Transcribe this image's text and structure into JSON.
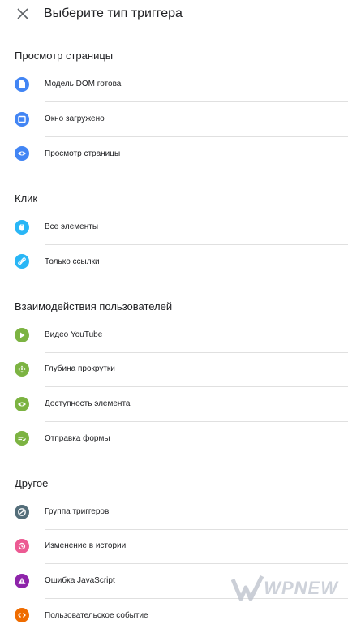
{
  "header": {
    "title": "Выберите тип триггера"
  },
  "sections": [
    {
      "title": "Просмотр страницы",
      "items": [
        {
          "label": "Модель DOM готова",
          "icon": "document-icon",
          "color": "#4285f4"
        },
        {
          "label": "Окно загружено",
          "icon": "window-icon",
          "color": "#4285f4"
        },
        {
          "label": "Просмотр страницы",
          "icon": "eye-icon",
          "color": "#4285f4"
        }
      ]
    },
    {
      "title": "Клик",
      "items": [
        {
          "label": "Все элементы",
          "icon": "mouse-icon",
          "color": "#29b6f6"
        },
        {
          "label": "Только ссылки",
          "icon": "link-icon",
          "color": "#29b6f6"
        }
      ]
    },
    {
      "title": "Взаимодействия пользователей",
      "items": [
        {
          "label": "Видео YouTube",
          "icon": "play-icon",
          "color": "#7cb342"
        },
        {
          "label": "Глубина прокрутки",
          "icon": "scroll-icon",
          "color": "#7cb342"
        },
        {
          "label": "Доступность элемента",
          "icon": "eye-icon",
          "color": "#7cb342"
        },
        {
          "label": "Отправка формы",
          "icon": "form-icon",
          "color": "#7cb342"
        }
      ]
    },
    {
      "title": "Другое",
      "items": [
        {
          "label": "Группа триггеров",
          "icon": "group-icon",
          "color": "#546e7a"
        },
        {
          "label": "Изменение в истории",
          "icon": "history-icon",
          "color": "#ec5a93"
        },
        {
          "label": "Ошибка JavaScript",
          "icon": "warning-icon",
          "color": "#8e24aa"
        },
        {
          "label": "Пользовательское событие",
          "icon": "code-icon",
          "color": "#ef6c00"
        }
      ]
    }
  ],
  "watermark": {
    "text": "WPNEW"
  }
}
